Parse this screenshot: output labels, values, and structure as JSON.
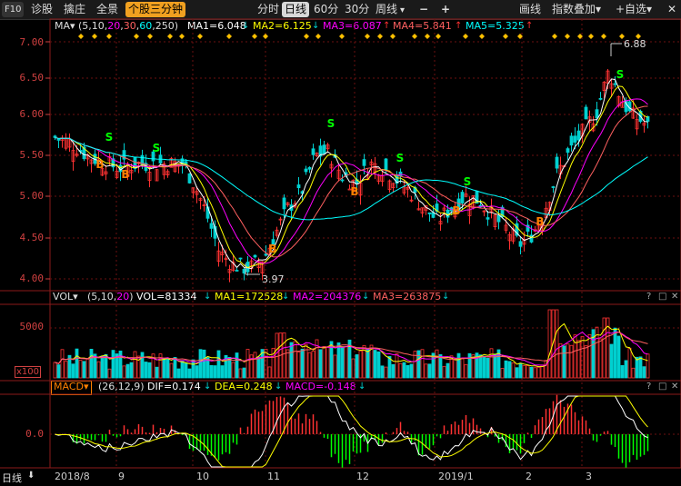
{
  "toolbar": {
    "f10": "F10",
    "tab_diagnose": "诊股",
    "tab_pick": "擒庄",
    "tab_panorama": "全景",
    "tab_stock3min": "个股三分钟",
    "period_fenshi": "分时",
    "period_day": "日线",
    "period_60": "60分",
    "period_30": "30分",
    "period_week": "周线",
    "period_arrow": "▾",
    "minus": "−",
    "plus": "+",
    "draw_line": "画线",
    "index_overlay": "指数叠加▾",
    "add_watchlist": "+自选▾",
    "close": "✕"
  },
  "colors": {
    "up": "#ff3232",
    "down": "#00d0d0",
    "ma1": "#ffffff",
    "ma2": "#ffff00",
    "ma3": "#ff00ff",
    "ma4": "#ff6060",
    "ma5": "#00ffff",
    "axis_red": "#d04040",
    "buy": "#ff8000",
    "sell": "#00ff00",
    "diamond": "#ffc000"
  },
  "main_panel": {
    "indicator_name": "MA▾",
    "params": "(5,10,20,30,60,250)",
    "ma1": "MA1=6.048",
    "ma2": "MA2=6.125",
    "ma3": "MA3=6.087",
    "ma4": "MA4=5.841",
    "ma5": "MA5=5.325",
    "arrow_down": "↓",
    "arrow_up": "↑",
    "high_label": "6.88",
    "low_label": "3.97",
    "buy_label": "B",
    "sell_label": "S",
    "y_ticks": [
      "7.00",
      "6.50",
      "6.00",
      "5.50",
      "5.00",
      "4.50",
      "4.00"
    ]
  },
  "vol_panel": {
    "indicator_name": "VOL▾",
    "params": "(5,10,20)",
    "vol": "VOL=81334",
    "ma1": "MA1=172528",
    "ma2": "MA2=204376",
    "ma3": "MA3=263875",
    "arrow_down": "↓",
    "y_tick": "5000",
    "unit": "x100"
  },
  "macd_panel": {
    "indicator_name": "MACD▾",
    "params": "(26,12,9)",
    "dif": "DIF=0.174",
    "dea": "DEA=0.248",
    "macd": "MACD=-0.148",
    "arrow_down": "↓",
    "y_tick": "0.0"
  },
  "panel_controls": {
    "help": "?",
    "maximize": "□",
    "close": "✕"
  },
  "x_axis": {
    "period_label": "日线",
    "period_arrow": "⬇",
    "labels": [
      "2018/8",
      "9",
      "10",
      "11",
      "12",
      "2019/1",
      "2",
      "3"
    ]
  },
  "chart_data": {
    "type": "candlestick",
    "y_range": [
      3.9,
      7.05
    ],
    "high": 6.88,
    "low": 3.97,
    "ma_values": {
      "MA1": 6.048,
      "MA2": 6.125,
      "MA3": 6.087,
      "MA4": 5.841,
      "MA5": 5.325
    },
    "vol_latest": 81334,
    "macd": {
      "DIF": 0.174,
      "DEA": 0.248,
      "MACD": -0.148
    }
  }
}
